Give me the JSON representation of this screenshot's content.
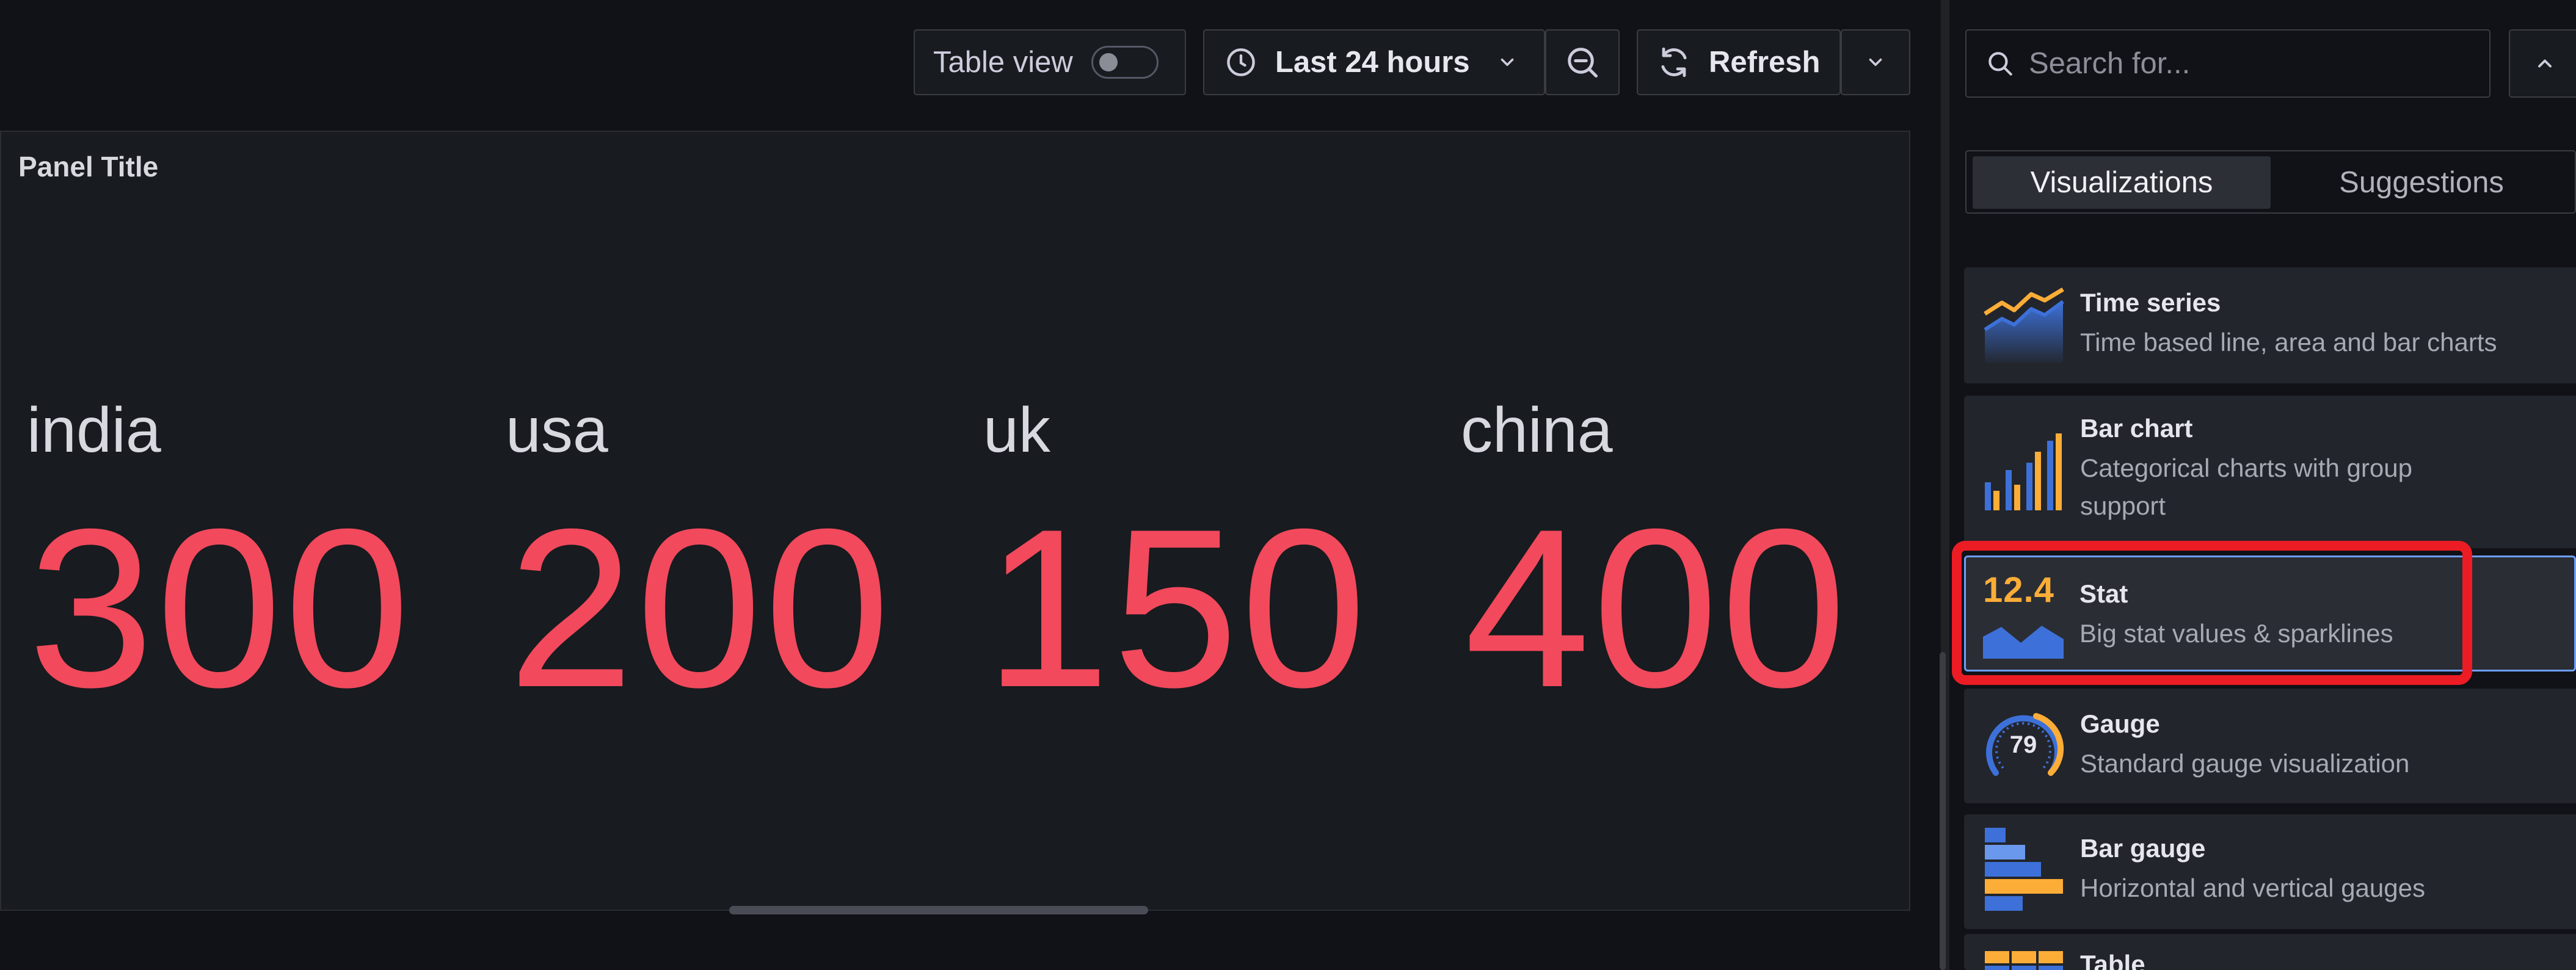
{
  "toolbar": {
    "table_view_label": "Table view",
    "time_range_label": "Last 24 hours",
    "refresh_label": "Refresh"
  },
  "panel": {
    "title": "Panel Title",
    "stats": [
      {
        "name": "india",
        "value": "300"
      },
      {
        "name": "usa",
        "value": "200"
      },
      {
        "name": "uk",
        "value": "150"
      },
      {
        "name": "china",
        "value": "400"
      }
    ],
    "value_color": "#f2495c"
  },
  "sidebar": {
    "search_placeholder": "Search for...",
    "tabs": [
      {
        "label": "Visualizations",
        "active": true
      },
      {
        "label": "Suggestions",
        "active": false
      }
    ],
    "visualizations": [
      {
        "name": "Time series",
        "description": "Time based line, area and bar charts",
        "icon": "time-series-icon"
      },
      {
        "name": "Bar chart",
        "description_line1": "Categorical charts with group",
        "description_line2": "support",
        "icon": "bar-chart-icon"
      },
      {
        "name": "Stat",
        "description": "Big stat values & sparklines",
        "icon": "stat-icon",
        "icon_text": "12.4",
        "selected": true
      },
      {
        "name": "Gauge",
        "description": "Standard gauge visualization",
        "icon": "gauge-icon",
        "icon_text": "79"
      },
      {
        "name": "Bar gauge",
        "description": "Horizontal and vertical gauges",
        "icon": "bar-gauge-icon"
      },
      {
        "name": "Table",
        "icon": "table-icon"
      }
    ]
  },
  "colors": {
    "accent_blue": "#6e9fff",
    "highlight_red": "#ec1c24",
    "icon_yellow": "#fbad37",
    "icon_blue": "#3d71d9"
  }
}
